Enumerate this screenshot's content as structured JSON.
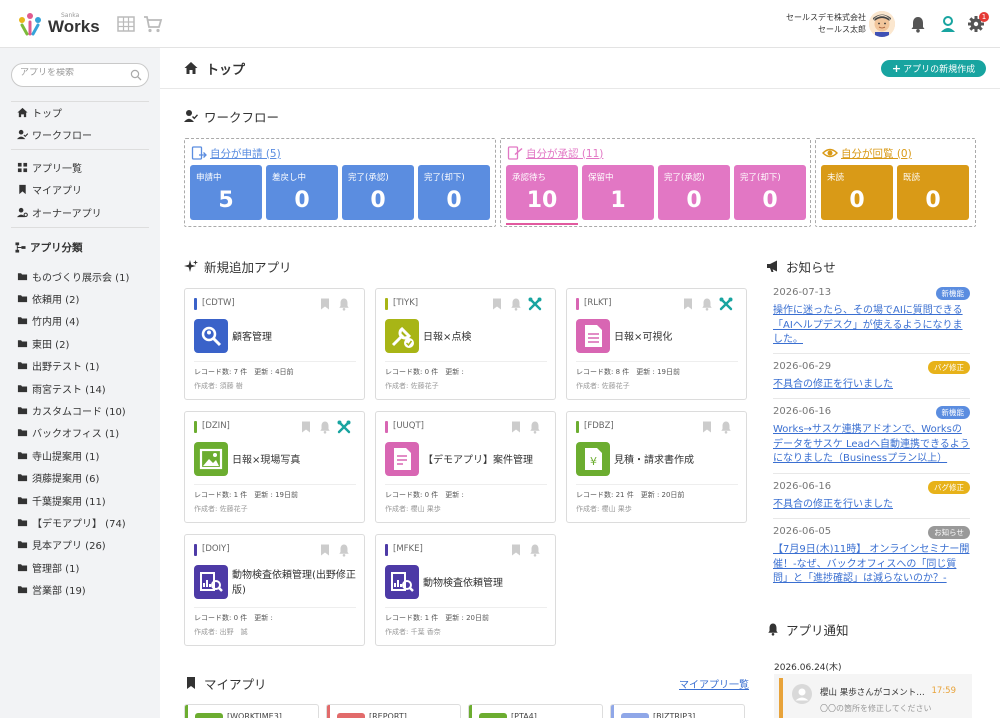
{
  "header": {
    "logo_sub": "Sanka",
    "logo_text": "Works",
    "company": "セールスデモ株式会社",
    "user": "セールス太郎",
    "settings_badge": "1"
  },
  "sidebar": {
    "search_placeholder": "アプリを検索",
    "nav": [
      {
        "label": "トップ"
      },
      {
        "label": "ワークフロー"
      },
      {
        "label": "アプリ一覧"
      },
      {
        "label": "マイアプリ"
      },
      {
        "label": "オーナーアプリ"
      }
    ],
    "category_heading": "アプリ分類",
    "categories": [
      {
        "label": "ものづくり展示会 (1)"
      },
      {
        "label": "依頼用 (2)"
      },
      {
        "label": "竹内用 (4)"
      },
      {
        "label": "東田 (2)"
      },
      {
        "label": "出野テスト (1)"
      },
      {
        "label": "雨宮テスト (14)"
      },
      {
        "label": "カスタムコード (10)"
      },
      {
        "label": "バックオフィス (1)"
      },
      {
        "label": "寺山提案用 (1)"
      },
      {
        "label": "須藤提案用 (6)"
      },
      {
        "label": "千葉提案用 (11)"
      },
      {
        "label": "【デモアプリ】 (74)"
      },
      {
        "label": "見本アプリ (26)"
      },
      {
        "label": "管理部 (1)"
      },
      {
        "label": "営業部 (19)"
      }
    ]
  },
  "main": {
    "page_title": "トップ",
    "new_app_button": "アプリの新規作成",
    "workflow": {
      "title": "ワークフロー",
      "groups": [
        {
          "title": "自分が申請 (5)",
          "color": "#5b8de0",
          "tiles": [
            {
              "label": "申請中",
              "count": "5"
            },
            {
              "label": "差戻し中",
              "count": "0"
            },
            {
              "label": "完了(承認)",
              "count": "0"
            },
            {
              "label": "完了(却下)",
              "count": "0"
            }
          ]
        },
        {
          "title": "自分が承認 (11)",
          "color": "#e277c4",
          "tiles": [
            {
              "label": "承認待ち",
              "count": "10"
            },
            {
              "label": "保留中",
              "count": "1"
            },
            {
              "label": "完了(承認)",
              "count": "0"
            },
            {
              "label": "完了(却下)",
              "count": "0"
            }
          ]
        },
        {
          "title": "自分が回覧 (0)",
          "color": "#d99a17",
          "tiles": [
            {
              "label": "未読",
              "count": "0"
            },
            {
              "label": "既読",
              "count": "0"
            }
          ]
        }
      ]
    },
    "new_apps": {
      "title": "新規追加アプリ",
      "cards": [
        {
          "code": "[CDTW]",
          "name": "顧客管理",
          "meta": "レコード数: 7 件　更新 : 4日前",
          "author": "作成者: 須藤 樹",
          "accent": "#3a62c9",
          "tool": false
        },
        {
          "code": "[TIYK]",
          "name": "日報×点検",
          "meta": "レコード数: 0 件　更新 :",
          "author": "作成者: 佐藤花子",
          "accent": "#a8b516",
          "tool": true
        },
        {
          "code": "[RLKT]",
          "name": "日報×可視化",
          "meta": "レコード数: 8 件　更新 : 19日前",
          "author": "作成者: 佐藤花子",
          "accent": "#d866b3",
          "tool": true
        },
        {
          "code": "[DZIN]",
          "name": "日報×現場写真",
          "meta": "レコード数: 1 件　更新 : 19日前",
          "author": "作成者: 佐藤花子",
          "accent": "#6cad30",
          "tool": true
        },
        {
          "code": "[UUQT]",
          "name": "【デモアプリ】案件管理",
          "meta": "レコード数: 0 件　更新 :",
          "author": "作成者: 櫻山 果歩",
          "accent": "#d866b3",
          "tool": false
        },
        {
          "code": "[FDBZ]",
          "name": "見積・請求書作成",
          "meta": "レコード数: 21 件　更新 : 20日前",
          "author": "作成者: 櫻山 果歩",
          "accent": "#6cad30",
          "tool": false
        },
        {
          "code": "[DOIY]",
          "name": "動物検査依頼管理(出野修正版)",
          "meta": "レコード数: 0 件　更新 :",
          "author": "作成者: 出野　誠",
          "accent": "#4d3aa6",
          "tool": false
        },
        {
          "code": "[MFKE]",
          "name": "動物検査依頼管理",
          "meta": "レコード数: 1 件　更新 : 20日前",
          "author": "作成者: 千葉 香奈",
          "accent": "#4d3aa6",
          "tool": false
        }
      ]
    },
    "my_apps": {
      "title": "マイアプリ",
      "link": "マイアプリ一覧",
      "items": [
        {
          "code": "[WORKTIME3]",
          "color": "#6cad30"
        },
        {
          "code": "[REPORT]",
          "color": "#e26b6b"
        },
        {
          "code": "[PTA4]",
          "color": "#6cad30"
        },
        {
          "code": "[BIZTRIP3]",
          "color": "#8fa7e8"
        }
      ]
    }
  },
  "news": {
    "title": "お知らせ",
    "items": [
      {
        "date": "2026-07-13",
        "badge": "新機能",
        "badge_color": "#5b8de0",
        "text": "操作に迷ったら、その場でAIに質問できる「AIヘルプデスク」が使えるようになりました。"
      },
      {
        "date": "2026-06-29",
        "badge": "バグ修正",
        "badge_color": "#e7b21a",
        "text": "不具合の修正を行いました"
      },
      {
        "date": "2026-06-16",
        "badge": "新機能",
        "badge_color": "#5b8de0",
        "text": "Works→サスケ連携アドオンで、Worksのデータをサスケ Leadへ自動連携できるようになりました（Businessプラン以上）"
      },
      {
        "date": "2026-06-16",
        "badge": "バグ修正",
        "badge_color": "#e7b21a",
        "text": "不具合の修正を行いました"
      },
      {
        "date": "2026-06-05",
        "badge": "お知らせ",
        "badge_color": "#999999",
        "text": "【7月9日(木)11時】 オンラインセミナー開催！-なぜ、バックオフィスへの「同じ質問」と「進捗確認」は減らないのか？-"
      }
    ]
  },
  "notifications": {
    "title": "アプリ通知",
    "date": "2026.06.24(木)",
    "item": {
      "text": "櫻山 果歩さんがコメント…",
      "time": "17:59",
      "sub": "〇〇の箇所を修正してください"
    }
  }
}
